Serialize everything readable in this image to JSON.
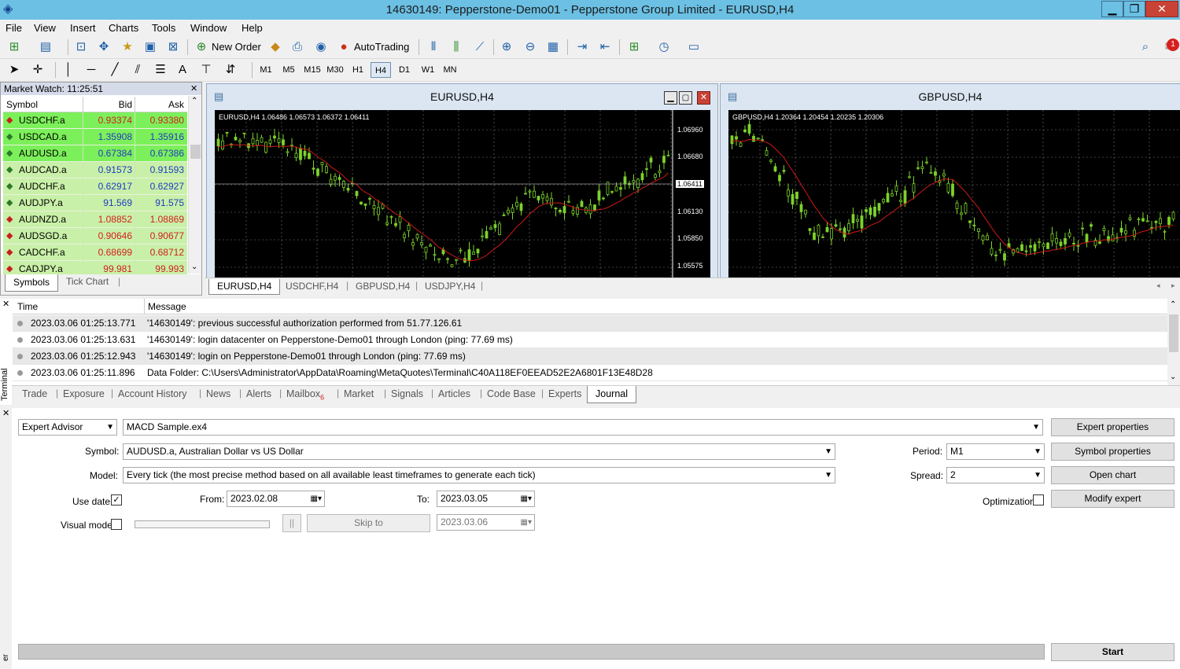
{
  "window": {
    "title": "14630149: Pepperstone-Demo01 - Pepperstone Group Limited - EURUSD,H4"
  },
  "menu": [
    "File",
    "View",
    "Insert",
    "Charts",
    "Tools",
    "Window",
    "Help"
  ],
  "toolbar": {
    "new_order": "New Order",
    "autotrading": "AutoTrading",
    "notif_count": "1",
    "text_tool": "A"
  },
  "timeframes": [
    "M1",
    "M5",
    "M15",
    "M30",
    "H1",
    "H4",
    "D1",
    "W1",
    "MN"
  ],
  "market_watch": {
    "header": "Market Watch: 11:25:51",
    "columns": [
      "Symbol",
      "Bid",
      "Ask"
    ],
    "rows": [
      {
        "symbol": "USDCHF.a",
        "bid": "0.93374",
        "ask": "0.93380",
        "dir": "down"
      },
      {
        "symbol": "USDCAD.a",
        "bid": "1.35908",
        "ask": "1.35916",
        "dir": "up"
      },
      {
        "symbol": "AUDUSD.a",
        "bid": "0.67384",
        "ask": "0.67386",
        "dir": "up"
      },
      {
        "symbol": "AUDCAD.a",
        "bid": "0.91573",
        "ask": "0.91593",
        "dir": "up"
      },
      {
        "symbol": "AUDCHF.a",
        "bid": "0.62917",
        "ask": "0.62927",
        "dir": "up"
      },
      {
        "symbol": "AUDJPY.a",
        "bid": "91.569",
        "ask": "91.575",
        "dir": "up"
      },
      {
        "symbol": "AUDNZD.a",
        "bid": "1.08852",
        "ask": "1.08869",
        "dir": "down"
      },
      {
        "symbol": "AUDSGD.a",
        "bid": "0.90646",
        "ask": "0.90677",
        "dir": "down"
      },
      {
        "symbol": "CADCHF.a",
        "bid": "0.68699",
        "ask": "0.68712",
        "dir": "down"
      },
      {
        "symbol": "CADJPY.a",
        "bid": "99.981",
        "ask": "99.993",
        "dir": "down"
      }
    ],
    "tabs": [
      "Symbols",
      "Tick Chart"
    ]
  },
  "charts": [
    {
      "title": "EURUSD,H4",
      "info": "EURUSD,H4  1.06486 1.06573 1.06372 1.06411",
      "price_labels": [
        "1.06960",
        "1.06680",
        "1.06411",
        "1.06130",
        "1.05850",
        "1.05575"
      ]
    },
    {
      "title": "GBPUSD,H4",
      "info": "GBPUSD,H4  1.20364 1.20454 1.20235 1.20306"
    }
  ],
  "chart_tabs": [
    "EURUSD,H4",
    "USDCHF,H4",
    "GBPUSD,H4",
    "USDJPY,H4"
  ],
  "terminal": {
    "side_label": "Terminal",
    "columns": [
      "Time",
      "Message"
    ],
    "rows": [
      {
        "time": "2023.03.06 01:25:13.771",
        "message": "'14630149': previous successful authorization performed from 51.77.126.61"
      },
      {
        "time": "2023.03.06 01:25:13.631",
        "message": "'14630149': login datacenter on Pepperstone-Demo01 through London (ping: 77.69 ms)"
      },
      {
        "time": "2023.03.06 01:25:12.943",
        "message": "'14630149': login on Pepperstone-Demo01 through London (ping: 77.69 ms)"
      },
      {
        "time": "2023.03.06 01:25:11.896",
        "message": "Data Folder: C:\\Users\\Administrator\\AppData\\Roaming\\MetaQuotes\\Terminal\\C40A118EF0EEAD52E2A6801F13E48D28"
      }
    ],
    "tabs": [
      "Trade",
      "Exposure",
      "Account History",
      "News",
      "Alerts",
      "Mailbox",
      "Market",
      "Signals",
      "Articles",
      "Code Base",
      "Experts",
      "Journal"
    ],
    "mailbox_count": "6"
  },
  "tester": {
    "type": "Expert Advisor",
    "expert": "MACD Sample.ex4",
    "symbol_label": "Symbol:",
    "symbol": "AUDUSD.a, Australian Dollar vs US Dollar",
    "model_label": "Model:",
    "model": "Every tick (the most precise method based on all available least timeframes to generate each tick)",
    "use_date_label": "Use date",
    "from_label": "From:",
    "from": "2023.02.08",
    "to_label": "To:",
    "to": "2023.03.05",
    "visual_mode_label": "Visual mode",
    "skip_to_label": "Skip to",
    "skip_date": "2023.03.06",
    "period_label": "Period:",
    "period": "M1",
    "spread_label": "Spread:",
    "spread": "2",
    "optimization_label": "Optimization",
    "buttons": {
      "expert_properties": "Expert properties",
      "symbol_properties": "Symbol properties",
      "open_chart": "Open chart",
      "modify_expert": "Modify expert",
      "start": "Start",
      "pause": "||"
    },
    "side_label": "er"
  },
  "colors": {
    "titlebar": "#6bc0e4",
    "mw_green": "#c9f0a8",
    "mw_bright": "#7cf05a",
    "bid_up": "#1f3bc4",
    "bid_down": "#d11f1f",
    "candle": "#7cd32a",
    "ma": "#d01818"
  }
}
